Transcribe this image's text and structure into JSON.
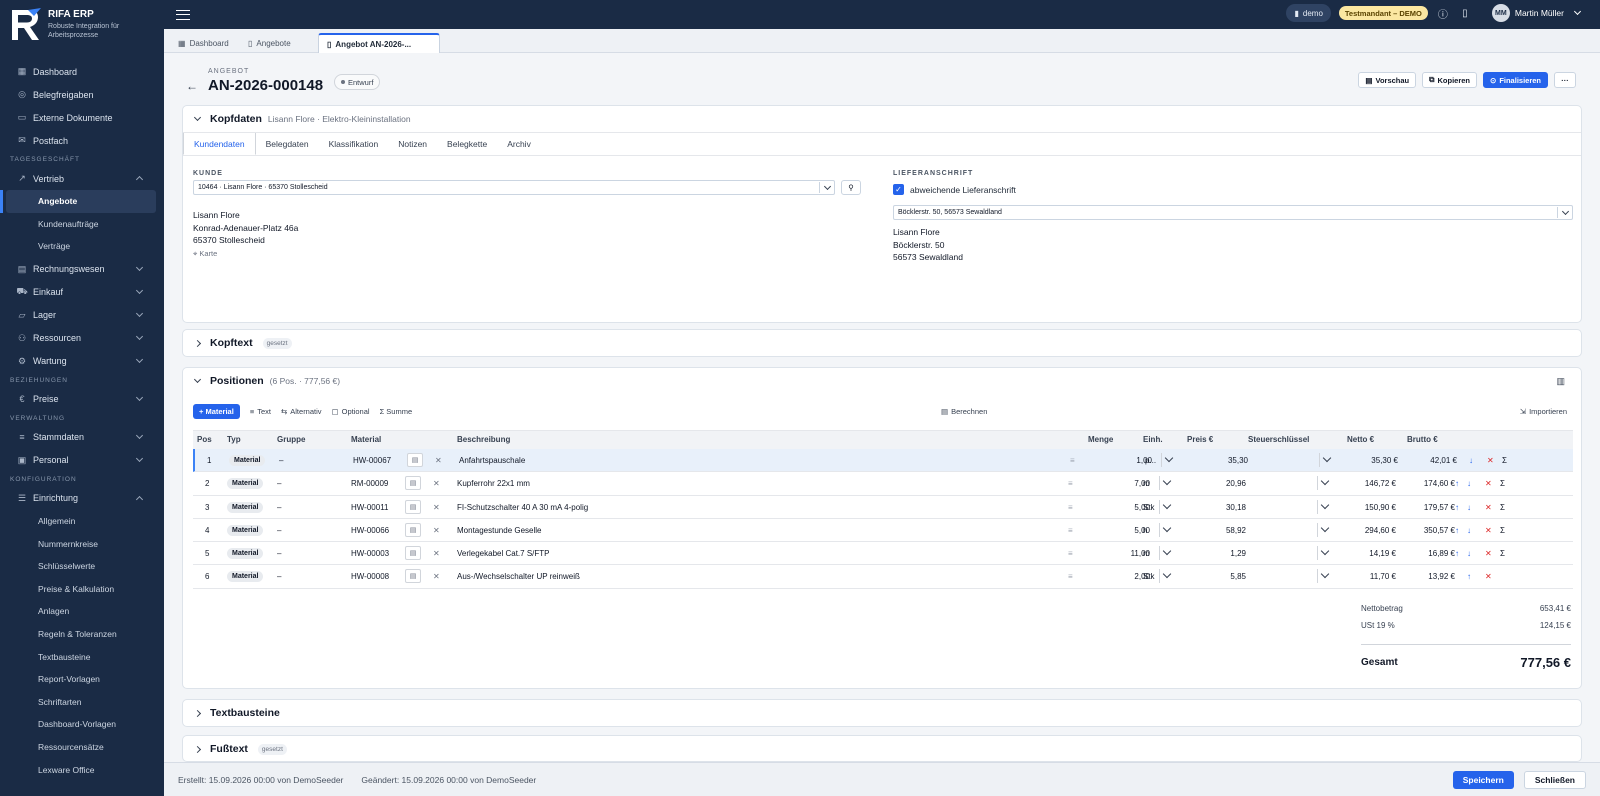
{
  "app": {
    "name": "RIFA ERP",
    "tagline": "Robuste Integration für Arbeitsprozesse"
  },
  "sidebar": {
    "top": [
      {
        "label": "Dashboard",
        "icon": "grid-icon"
      },
      {
        "label": "Belegfreigaben",
        "icon": "check-circle-icon"
      },
      {
        "label": "Externe Dokumente",
        "icon": "folder-icon"
      },
      {
        "label": "Postfach",
        "icon": "inbox-icon"
      }
    ],
    "sections": {
      "tagesgeschaeft": "TAGESGESCHÄFT",
      "beziehungen": "BEZIEHUNGEN",
      "verwaltung": "VERWALTUNG",
      "konfiguration": "KONFIGURATION"
    },
    "vertrieb": {
      "label": "Vertrieb",
      "subs": [
        "Angebote",
        "Kundenaufträge",
        "Verträge"
      ]
    },
    "groups1": [
      "Rechnungswesen",
      "Einkauf",
      "Lager",
      "Ressourcen",
      "Wartung"
    ],
    "preise": "Preise",
    "groups2": [
      "Stammdaten",
      "Personal"
    ],
    "einrichtung": {
      "label": "Einrichtung",
      "subs": [
        "Allgemein",
        "Nummernkreise",
        "Schlüsselwerte",
        "Preise & Kalkulation",
        "Anlagen",
        "Regeln & Toleranzen",
        "Textbausteine",
        "Report-Vorlagen",
        "Schriftarten",
        "Dashboard-Vorlagen",
        "Ressourcensätze",
        "Lexware Office"
      ]
    }
  },
  "topbar": {
    "tenant": "demo",
    "test_badge": "Testmandant – DEMO",
    "user_initials": "MM",
    "user_name": "Martin Müller"
  },
  "tabs": [
    "Dashboard",
    "Angebote",
    "Angebot AN-2026-..."
  ],
  "doc": {
    "kind": "ANGEBOT",
    "number": "AN-2026-000148",
    "status": "Entwurf",
    "actions": {
      "preview": "Vorschau",
      "copy": "Kopieren",
      "finalize": "Finalisieren",
      "more": "···"
    }
  },
  "kopfdaten": {
    "title": "Kopfdaten",
    "subtitle": "Lisann Flore · Elektro-Kleininstallation",
    "tabs": [
      "Kundendaten",
      "Belegdaten",
      "Klassifikation",
      "Notizen",
      "Belegkette",
      "Archiv"
    ],
    "kunde_label": "KUNDE",
    "kunde_value": "10464 · Lisann Flore · 65370 Stollescheid",
    "kunde_addr": [
      "Lisann Flore",
      "Konrad-Adenauer-Platz 46a",
      "65370 Stollescheid"
    ],
    "karte": "Karte",
    "liefer_label": "LIEFERANSCHRIFT",
    "liefer_check": "abweichende Lieferanschrift",
    "liefer_value": "Böcklerstr. 50, 56573 Sewaldland",
    "liefer_addr": [
      "Lisann Flore",
      "Böcklerstr. 50",
      "56573 Sewaldland"
    ]
  },
  "kopftext": {
    "title": "Kopftext",
    "tag": "gesetzt"
  },
  "positionen": {
    "title": "Positionen",
    "summary": "(6 Pos. · 777,56 €)",
    "toolbar": {
      "material": "+ Material",
      "text": "Text",
      "alternativ": "Alternativ",
      "optional": "Optional",
      "summe": "Σ Summe",
      "berechnen": "Berechnen",
      "importieren": "Importieren"
    },
    "columns": [
      "Pos",
      "Typ",
      "Gruppe",
      "Material",
      "Beschreibung",
      "Menge",
      "Einh.",
      "Preis €",
      "Steuerschlüssel",
      "Netto €",
      "Brutto €"
    ],
    "rows": [
      {
        "pos": "1",
        "typ": "Material",
        "gruppe": "–",
        "material": "HW-00067",
        "beschreibung": "Anfahrtspauschale",
        "menge": "1,00",
        "einh": "p...",
        "preis": "35,30",
        "netto": "35,30 €",
        "brutto": "42,01 €"
      },
      {
        "pos": "2",
        "typ": "Material",
        "gruppe": "–",
        "material": "RM-00009",
        "beschreibung": "Kupferrohr 22x1 mm",
        "menge": "7,00",
        "einh": "m",
        "preis": "20,96",
        "netto": "146,72 €",
        "brutto": "174,60 €"
      },
      {
        "pos": "3",
        "typ": "Material",
        "gruppe": "–",
        "material": "HW-00011",
        "beschreibung": "FI-Schutzschalter 40 A 30 mA 4-polig",
        "menge": "5,00",
        "einh": "Stk",
        "preis": "30,18",
        "netto": "150,90 €",
        "brutto": "179,57 €"
      },
      {
        "pos": "4",
        "typ": "Material",
        "gruppe": "–",
        "material": "HW-00066",
        "beschreibung": "Montagestunde Geselle",
        "menge": "5,00",
        "einh": "h",
        "preis": "58,92",
        "netto": "294,60 €",
        "brutto": "350,57 €"
      },
      {
        "pos": "5",
        "typ": "Material",
        "gruppe": "–",
        "material": "HW-00003",
        "beschreibung": "Verlegekabel Cat.7 S/FTP",
        "menge": "11,00",
        "einh": "m",
        "preis": "1,29",
        "netto": "14,19 €",
        "brutto": "16,89 €"
      },
      {
        "pos": "6",
        "typ": "Material",
        "gruppe": "–",
        "material": "HW-00008",
        "beschreibung": "Aus-/Wechselschalter UP reinweiß",
        "menge": "2,00",
        "einh": "Stk",
        "preis": "5,85",
        "netto": "11,70 €",
        "brutto": "13,92 €"
      }
    ],
    "totals": {
      "net_label": "Nettobetrag",
      "net": "653,41 €",
      "vat_label": "USt 19 %",
      "vat": "124,15 €",
      "total_label": "Gesamt",
      "total": "777,56 €"
    }
  },
  "textbausteine": {
    "title": "Textbausteine"
  },
  "fusstext": {
    "title": "Fußtext",
    "tag": "gesetzt"
  },
  "footer": {
    "created": "Erstellt: 15.09.2026 00:00 von DemoSeeder",
    "changed": "Geändert: 15.09.2026 00:00 von DemoSeeder",
    "save": "Speichern",
    "close": "Schließen"
  },
  "colors": {
    "sidebar": "#1a2b45",
    "accent": "#2563eb",
    "test_badge": "#fbe7a1"
  }
}
